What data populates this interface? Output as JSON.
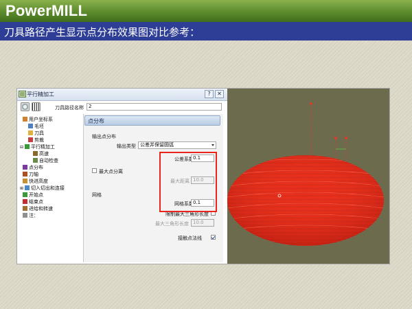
{
  "header": {
    "brand": "PowerMILL",
    "subtitle": "刀具路径产生显示点分布效果图对比参考："
  },
  "dialog": {
    "title": "平行精加工",
    "help_btn": "?",
    "close_btn": "✕",
    "toolpath_name_label": "刀具路径名称",
    "toolpath_name_value": "2"
  },
  "tree": {
    "items": [
      {
        "label": "用户坐标系",
        "icon": "ucs-icon"
      },
      {
        "label": "毛坯",
        "icon": "block-icon"
      },
      {
        "label": "刀具",
        "icon": "tool-icon"
      },
      {
        "label": "剪裁",
        "icon": "limit-icon"
      },
      {
        "label": "平行精加工",
        "icon": "raster-finish-icon"
      },
      {
        "label": "高速",
        "icon": "high-speed-icon"
      },
      {
        "label": "自动检查",
        "icon": "auto-verify-icon"
      },
      {
        "label": "点分布",
        "icon": "point-distribution-icon"
      },
      {
        "label": "刀轴",
        "icon": "tool-axis-icon"
      },
      {
        "label": "快进高度",
        "icon": "rapid-height-icon"
      },
      {
        "label": "切入切出和连接",
        "icon": "leads-links-icon"
      },
      {
        "label": "开始点",
        "icon": "start-point-icon"
      },
      {
        "label": "结束点",
        "icon": "end-point-icon"
      },
      {
        "label": "进给和转速",
        "icon": "feeds-speeds-icon"
      },
      {
        "label": "注：",
        "icon": "notes-icon"
      }
    ]
  },
  "panel": {
    "section_title": "点分布",
    "output_group": "输出点分布",
    "output_type_label": "输出类型",
    "output_type_value": "公差并保留圆弧",
    "tolerance_factor_label": "公差系数",
    "tolerance_factor_value": "0.1",
    "max_spacing_label": "最大点分离",
    "max_distance_label": "最大距离",
    "max_distance_value": "10.0",
    "mesh_group": "网格",
    "mesh_factor_label": "网格系数",
    "mesh_factor_value": "0.1",
    "limit_triangle_label": "限制最大三角形长度",
    "max_triangle_label": "最大三角形长度",
    "max_triangle_value": "10.0",
    "contact_normal_label": "接触点法线"
  },
  "colors": {
    "header_green": "#5c8b2d",
    "subtitle_blue": "#2e3e96",
    "highlight_red": "#e8241c",
    "toolpath_red": "#ff2a1a",
    "viewport_olive": "#6c6b4e"
  }
}
